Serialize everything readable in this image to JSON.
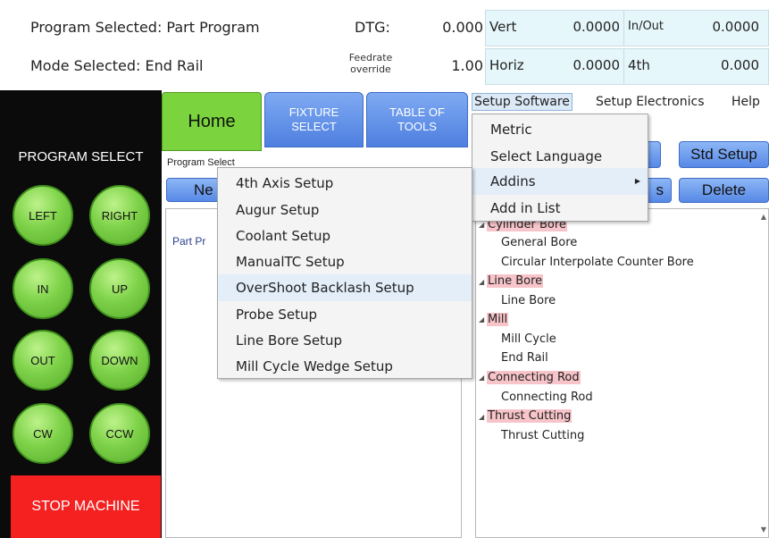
{
  "status": {
    "program_selected": "Program Selected: Part Program",
    "mode_selected": "Mode Selected: End Rail",
    "dtg_label": "DTG:",
    "dtg_value": "0.000",
    "feedrate_label_1": "Feedrate",
    "feedrate_label_2": "override",
    "feedrate_value": "1.00"
  },
  "axes": [
    {
      "label": "Vert",
      "value": "0.0000"
    },
    {
      "label": "In/Out",
      "value": "0.0000"
    },
    {
      "label": "Horiz",
      "value": "0.0000"
    },
    {
      "label": "4th",
      "value": "0.000"
    }
  ],
  "left_panel": {
    "title": "PROGRAM SELECT",
    "buttons": [
      "LEFT",
      "RIGHT",
      "IN",
      "UP",
      "OUT",
      "DOWN",
      "CW",
      "CCW"
    ],
    "stop_label": "STOP MACHINE"
  },
  "tabs": {
    "home": "Home",
    "fixture_select_1": "FIXTURE",
    "fixture_select_2": "SELECT",
    "table_of_tools_1": "TABLE OF",
    "table_of_tools_2": "TOOLS"
  },
  "program_select": {
    "label": "Program Select",
    "new_label": "Ne",
    "list_item": "Part Pr",
    "std_setup_label": "Std Setup",
    "s_label": "s",
    "delete_label": "Delete"
  },
  "menubar": [
    "Setup Software",
    "Setup Electronics",
    "Help"
  ],
  "setup_software_menu": [
    "Metric",
    "Select Language",
    "Addins",
    "Add in List"
  ],
  "addins_menu": [
    "4th Axis Setup",
    "Augur Setup",
    "Coolant Setup",
    "ManualTC Setup",
    "OverShoot Backlash Setup",
    "Probe Setup",
    "Line Bore Setup",
    "Mill Cycle Wedge Setup"
  ],
  "tree": {
    "cylinder_bore": "Cylinder Bore",
    "general_bore": "General Bore",
    "circular_interp": "Circular Interpolate Counter Bore",
    "line_bore_cat": "Line Bore",
    "line_bore": "Line Bore",
    "mill_cat": "Mill",
    "mill_cycle": "Mill Cycle",
    "end_rail": "End Rail",
    "connecting_rod_cat": "Connecting Rod",
    "connecting_rod": "Connecting Rod",
    "thrust_cutting_cat": "Thrust Cutting",
    "thrust_cutting": "Thrust Cutting"
  },
  "colors": {
    "green_button": "#7fd34a",
    "blue_tab": "#5a8ae6",
    "stop_red": "#f52020",
    "category_highlight": "#f7c4c9",
    "axis_cell": "#e6f7fb"
  }
}
